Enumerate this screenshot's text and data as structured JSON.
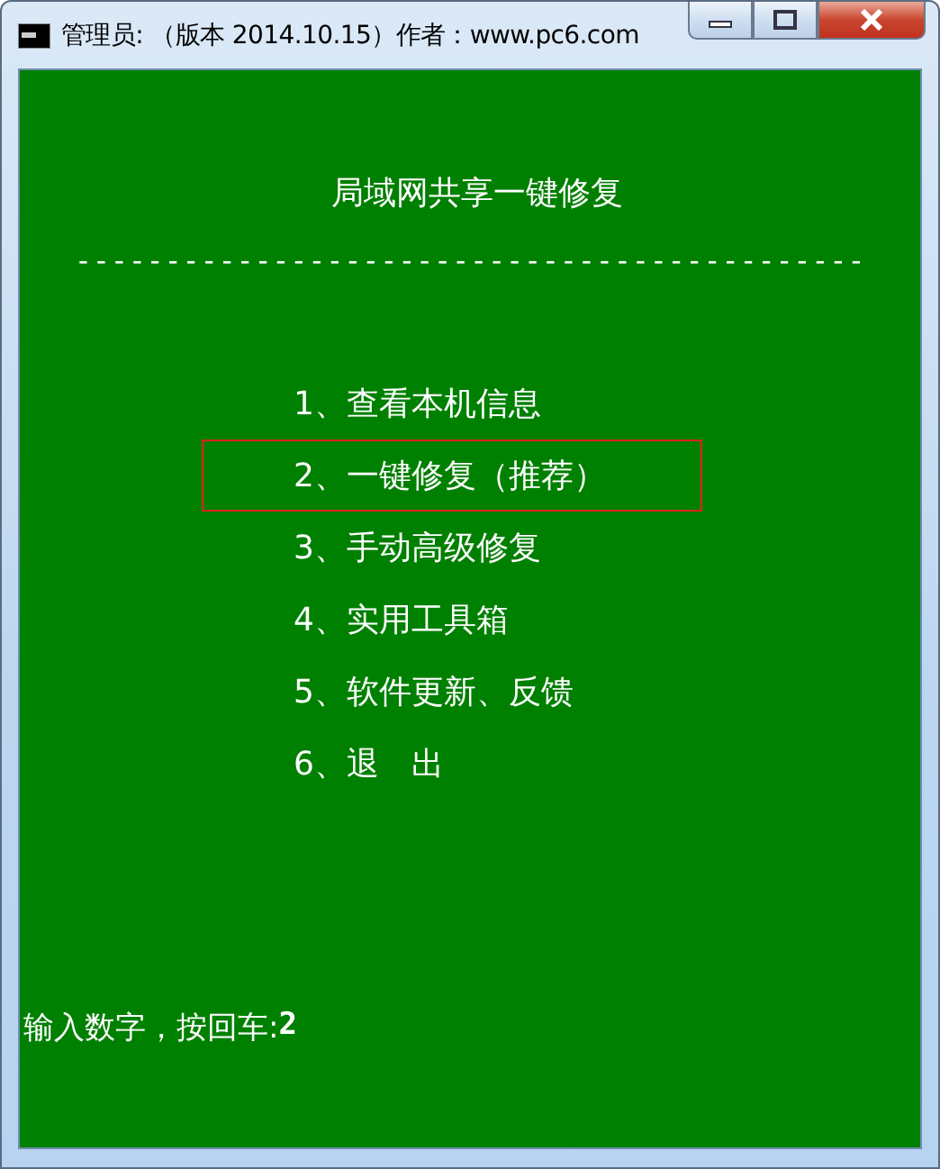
{
  "window": {
    "title": "管理员: （版本 2014.10.15）作者：www.pc6.com"
  },
  "console": {
    "heading": "局域网共享一键修复",
    "rule": "--------------------------------------------",
    "menu": [
      {
        "label": "1、查看本机信息",
        "selected": false
      },
      {
        "label": "2、一键修复（推荐）",
        "selected": true
      },
      {
        "label": "3、手动高级修复",
        "selected": false
      },
      {
        "label": "4、实用工具箱",
        "selected": false
      },
      {
        "label": "5、软件更新、反馈",
        "selected": false
      },
      {
        "label": "6、退　出",
        "selected": false
      }
    ],
    "prompt": "输入数字，按回车:",
    "value": "2"
  }
}
